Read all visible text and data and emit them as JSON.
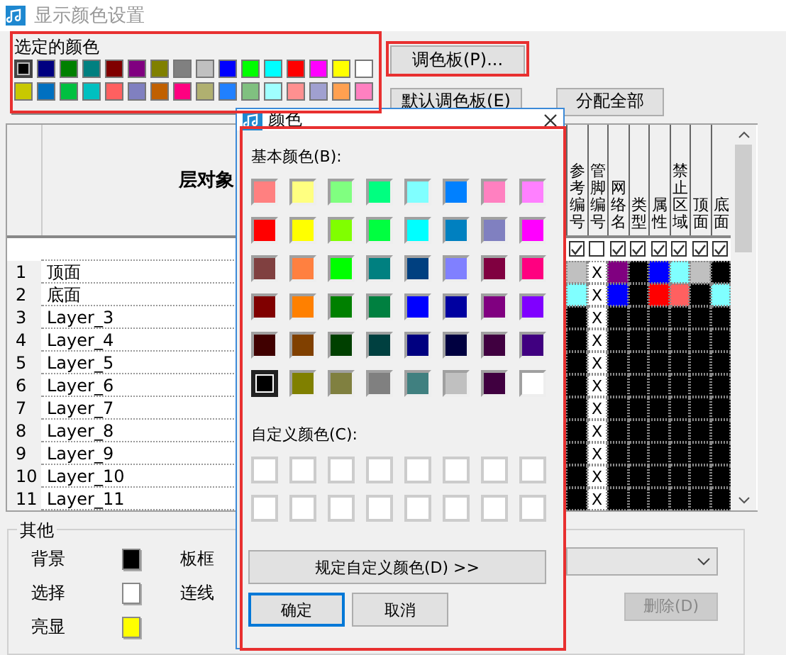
{
  "window": {
    "title": "显示颜色设置"
  },
  "selected_colors": {
    "label": "选定的颜色",
    "swatches": [
      {
        "color": "#000000",
        "selected": true
      },
      {
        "color": "#000080",
        "selected": false
      },
      {
        "color": "#008000",
        "selected": false
      },
      {
        "color": "#008080",
        "selected": false
      },
      {
        "color": "#800000",
        "selected": false
      },
      {
        "color": "#800080",
        "selected": false
      },
      {
        "color": "#808000",
        "selected": false
      },
      {
        "color": "#808080",
        "selected": false
      },
      {
        "color": "#c0c0c0",
        "selected": false
      },
      {
        "color": "#0000ff",
        "selected": false
      },
      {
        "color": "#00ff00",
        "selected": false
      },
      {
        "color": "#00ffff",
        "selected": false
      },
      {
        "color": "#ff0000",
        "selected": false
      },
      {
        "color": "#ff00ff",
        "selected": false
      },
      {
        "color": "#ffff00",
        "selected": false
      },
      {
        "color": "#ffffff",
        "selected": false
      },
      {
        "color": "#c8c800",
        "selected": false
      },
      {
        "color": "#0070c0",
        "selected": false
      },
      {
        "color": "#00c040",
        "selected": false
      },
      {
        "color": "#00c0c0",
        "selected": false
      },
      {
        "color": "#ff6060",
        "selected": false
      },
      {
        "color": "#8080c0",
        "selected": false
      },
      {
        "color": "#c06000",
        "selected": false
      },
      {
        "color": "#ff0080",
        "selected": false
      },
      {
        "color": "#b0b070",
        "selected": false
      },
      {
        "color": "#2080ff",
        "selected": false
      },
      {
        "color": "#80c080",
        "selected": false
      },
      {
        "color": "#a0ffff",
        "selected": false
      },
      {
        "color": "#ff9090",
        "selected": false
      },
      {
        "color": "#a0a0d0",
        "selected": false
      },
      {
        "color": "#ffa050",
        "selected": false
      },
      {
        "color": "#ff80c0",
        "selected": false
      }
    ]
  },
  "buttons": {
    "palette": "调色板(P)...",
    "default_palette": "默认调色板(E)",
    "assign_all": "分配全部"
  },
  "table": {
    "header": "层对象",
    "columns": [
      {
        "label": "参考编号",
        "checked": true
      },
      {
        "label": "管脚编号",
        "checked": false
      },
      {
        "label": "网络名",
        "checked": true
      },
      {
        "label": "类型",
        "checked": true
      },
      {
        "label": "属性",
        "checked": true
      },
      {
        "label": "禁止区域",
        "checked": true
      },
      {
        "label": "顶面",
        "checked": true
      },
      {
        "label": "底面",
        "checked": true
      }
    ],
    "rows": [
      {
        "number": "1",
        "name": "顶面",
        "cells": [
          {
            "kind": "color",
            "color": "#c0c0c0"
          },
          {
            "kind": "text",
            "text": "X"
          },
          {
            "kind": "color",
            "color": "#800080"
          },
          {
            "kind": "color",
            "color": "#000000"
          },
          {
            "kind": "color",
            "color": "#0000ff"
          },
          {
            "kind": "color",
            "color": "#80ffff"
          },
          {
            "kind": "color",
            "color": "#c0c0c0"
          },
          {
            "kind": "color",
            "color": "#000000"
          }
        ]
      },
      {
        "number": "2",
        "name": "底面",
        "cells": [
          {
            "kind": "color",
            "color": "#80ffff"
          },
          {
            "kind": "text",
            "text": "X"
          },
          {
            "kind": "color",
            "color": "#0000ff"
          },
          {
            "kind": "color",
            "color": "#000000"
          },
          {
            "kind": "color",
            "color": "#ff0000"
          },
          {
            "kind": "color",
            "color": "#ff6060"
          },
          {
            "kind": "color",
            "color": "#000000"
          },
          {
            "kind": "color",
            "color": "#80ffff"
          }
        ]
      },
      {
        "number": "3",
        "name": "Layer_3",
        "cells": [
          {
            "kind": "color",
            "color": "#000000"
          },
          {
            "kind": "text",
            "text": "X"
          },
          {
            "kind": "color",
            "color": "#000000"
          },
          {
            "kind": "color",
            "color": "#000000"
          },
          {
            "kind": "color",
            "color": "#000000"
          },
          {
            "kind": "color",
            "color": "#000000"
          },
          {
            "kind": "color",
            "color": "#000000"
          },
          {
            "kind": "color",
            "color": "#000000"
          }
        ]
      },
      {
        "number": "4",
        "name": "Layer_4",
        "cells": [
          {
            "kind": "color",
            "color": "#000000"
          },
          {
            "kind": "text",
            "text": "X"
          },
          {
            "kind": "color",
            "color": "#000000"
          },
          {
            "kind": "color",
            "color": "#000000"
          },
          {
            "kind": "color",
            "color": "#000000"
          },
          {
            "kind": "color",
            "color": "#000000"
          },
          {
            "kind": "color",
            "color": "#000000"
          },
          {
            "kind": "color",
            "color": "#000000"
          }
        ]
      },
      {
        "number": "5",
        "name": "Layer_5",
        "cells": [
          {
            "kind": "color",
            "color": "#000000"
          },
          {
            "kind": "text",
            "text": "X"
          },
          {
            "kind": "color",
            "color": "#000000"
          },
          {
            "kind": "color",
            "color": "#000000"
          },
          {
            "kind": "color",
            "color": "#000000"
          },
          {
            "kind": "color",
            "color": "#000000"
          },
          {
            "kind": "color",
            "color": "#000000"
          },
          {
            "kind": "color",
            "color": "#000000"
          }
        ]
      },
      {
        "number": "6",
        "name": "Layer_6",
        "cells": [
          {
            "kind": "color",
            "color": "#000000"
          },
          {
            "kind": "text",
            "text": "X"
          },
          {
            "kind": "color",
            "color": "#000000"
          },
          {
            "kind": "color",
            "color": "#000000"
          },
          {
            "kind": "color",
            "color": "#000000"
          },
          {
            "kind": "color",
            "color": "#000000"
          },
          {
            "kind": "color",
            "color": "#000000"
          },
          {
            "kind": "color",
            "color": "#000000"
          }
        ]
      },
      {
        "number": "7",
        "name": "Layer_7",
        "cells": [
          {
            "kind": "color",
            "color": "#000000"
          },
          {
            "kind": "text",
            "text": "X"
          },
          {
            "kind": "color",
            "color": "#000000"
          },
          {
            "kind": "color",
            "color": "#000000"
          },
          {
            "kind": "color",
            "color": "#000000"
          },
          {
            "kind": "color",
            "color": "#000000"
          },
          {
            "kind": "color",
            "color": "#000000"
          },
          {
            "kind": "color",
            "color": "#000000"
          }
        ]
      },
      {
        "number": "8",
        "name": "Layer_8",
        "cells": [
          {
            "kind": "color",
            "color": "#000000"
          },
          {
            "kind": "text",
            "text": "X"
          },
          {
            "kind": "color",
            "color": "#000000"
          },
          {
            "kind": "color",
            "color": "#000000"
          },
          {
            "kind": "color",
            "color": "#000000"
          },
          {
            "kind": "color",
            "color": "#000000"
          },
          {
            "kind": "color",
            "color": "#000000"
          },
          {
            "kind": "color",
            "color": "#000000"
          }
        ]
      },
      {
        "number": "9",
        "name": "Layer_9",
        "cells": [
          {
            "kind": "color",
            "color": "#000000"
          },
          {
            "kind": "text",
            "text": "X"
          },
          {
            "kind": "color",
            "color": "#000000"
          },
          {
            "kind": "color",
            "color": "#000000"
          },
          {
            "kind": "color",
            "color": "#000000"
          },
          {
            "kind": "color",
            "color": "#000000"
          },
          {
            "kind": "color",
            "color": "#000000"
          },
          {
            "kind": "color",
            "color": "#000000"
          }
        ]
      },
      {
        "number": "10",
        "name": "Layer_10",
        "cells": [
          {
            "kind": "color",
            "color": "#000000"
          },
          {
            "kind": "text",
            "text": "X"
          },
          {
            "kind": "color",
            "color": "#000000"
          },
          {
            "kind": "color",
            "color": "#000000"
          },
          {
            "kind": "color",
            "color": "#000000"
          },
          {
            "kind": "color",
            "color": "#000000"
          },
          {
            "kind": "color",
            "color": "#000000"
          },
          {
            "kind": "color",
            "color": "#000000"
          }
        ]
      },
      {
        "number": "11",
        "name": "Layer_11",
        "cells": [
          {
            "kind": "color",
            "color": "#000000"
          },
          {
            "kind": "text",
            "text": "X"
          },
          {
            "kind": "color",
            "color": "#000000"
          },
          {
            "kind": "color",
            "color": "#000000"
          },
          {
            "kind": "color",
            "color": "#000000"
          },
          {
            "kind": "color",
            "color": "#000000"
          },
          {
            "kind": "color",
            "color": "#000000"
          },
          {
            "kind": "color",
            "color": "#000000"
          }
        ]
      }
    ]
  },
  "other": {
    "label": "其他",
    "items": [
      {
        "label": "背景",
        "color": "#000000"
      },
      {
        "label": "选择",
        "color": "#ffffff"
      },
      {
        "label": "亮显",
        "color": "#ffff00"
      }
    ],
    "more_items": [
      "板框",
      "连线"
    ],
    "delete_button": {
      "label": "删除(D)",
      "disabled": true
    }
  },
  "color_dialog": {
    "title": "颜色",
    "basic_label": "基本颜色(B):",
    "basic_colors": [
      {
        "color": "#ff8080",
        "selected": false
      },
      {
        "color": "#ffff80",
        "selected": false
      },
      {
        "color": "#80ff80",
        "selected": false
      },
      {
        "color": "#00ff80",
        "selected": false
      },
      {
        "color": "#80ffff",
        "selected": false
      },
      {
        "color": "#0080ff",
        "selected": false
      },
      {
        "color": "#ff80c0",
        "selected": false
      },
      {
        "color": "#ff80ff",
        "selected": false
      },
      {
        "color": "#ff0000",
        "selected": false
      },
      {
        "color": "#ffff00",
        "selected": false
      },
      {
        "color": "#80ff00",
        "selected": false
      },
      {
        "color": "#00ff40",
        "selected": false
      },
      {
        "color": "#00ffff",
        "selected": false
      },
      {
        "color": "#0080c0",
        "selected": false
      },
      {
        "color": "#8080c0",
        "selected": false
      },
      {
        "color": "#ff00ff",
        "selected": false
      },
      {
        "color": "#804040",
        "selected": false
      },
      {
        "color": "#ff8040",
        "selected": false
      },
      {
        "color": "#00ff00",
        "selected": false
      },
      {
        "color": "#008080",
        "selected": false
      },
      {
        "color": "#004080",
        "selected": false
      },
      {
        "color": "#8080ff",
        "selected": false
      },
      {
        "color": "#800040",
        "selected": false
      },
      {
        "color": "#ff0080",
        "selected": false
      },
      {
        "color": "#800000",
        "selected": false
      },
      {
        "color": "#ff8000",
        "selected": false
      },
      {
        "color": "#008000",
        "selected": false
      },
      {
        "color": "#008040",
        "selected": false
      },
      {
        "color": "#0000ff",
        "selected": false
      },
      {
        "color": "#0000a0",
        "selected": false
      },
      {
        "color": "#800080",
        "selected": false
      },
      {
        "color": "#8000ff",
        "selected": false
      },
      {
        "color": "#400000",
        "selected": false
      },
      {
        "color": "#804000",
        "selected": false
      },
      {
        "color": "#004000",
        "selected": false
      },
      {
        "color": "#004040",
        "selected": false
      },
      {
        "color": "#000080",
        "selected": false
      },
      {
        "color": "#000040",
        "selected": false
      },
      {
        "color": "#400040",
        "selected": false
      },
      {
        "color": "#400080",
        "selected": false
      },
      {
        "color": "#000000",
        "selected": true
      },
      {
        "color": "#808000",
        "selected": false
      },
      {
        "color": "#808040",
        "selected": false
      },
      {
        "color": "#808080",
        "selected": false
      },
      {
        "color": "#408080",
        "selected": false
      },
      {
        "color": "#c0c0c0",
        "selected": false
      },
      {
        "color": "#400040",
        "selected": false
      },
      {
        "color": "#ffffff",
        "selected": false
      }
    ],
    "custom_label": "自定义颜色(C):",
    "custom_colors": [
      {
        "color": "#ffffff"
      },
      {
        "color": "#ffffff"
      },
      {
        "color": "#ffffff"
      },
      {
        "color": "#ffffff"
      },
      {
        "color": "#ffffff"
      },
      {
        "color": "#ffffff"
      },
      {
        "color": "#ffffff"
      },
      {
        "color": "#ffffff"
      },
      {
        "color": "#ffffff"
      },
      {
        "color": "#ffffff"
      },
      {
        "color": "#ffffff"
      },
      {
        "color": "#ffffff"
      },
      {
        "color": "#ffffff"
      },
      {
        "color": "#ffffff"
      },
      {
        "color": "#ffffff"
      },
      {
        "color": "#ffffff"
      }
    ],
    "define_button": "规定自定义颜色(D) >>",
    "ok_button": "确定",
    "cancel_button": "取消"
  }
}
